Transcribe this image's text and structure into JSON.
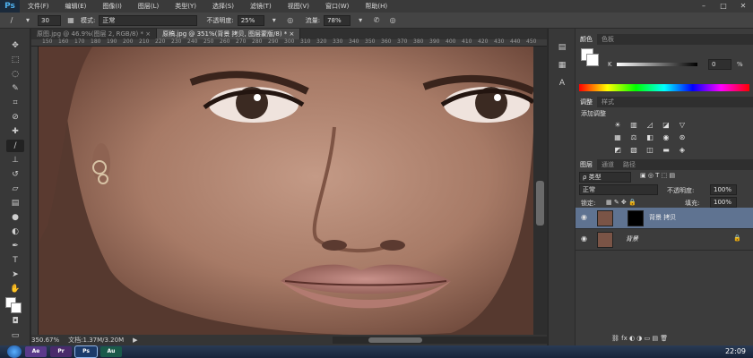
{
  "app": {
    "logo": "Ps"
  },
  "menu": [
    "文件(F)",
    "编辑(E)",
    "图像(I)",
    "图层(L)",
    "类型(Y)",
    "选择(S)",
    "滤镜(T)",
    "视图(V)",
    "窗口(W)",
    "帮助(H)"
  ],
  "options": {
    "brush_size": "30",
    "mode_label": "模式:",
    "mode_value": "正常",
    "opacity_label": "不透明度:",
    "opacity_value": "25%",
    "flow_label": "流量:",
    "flow_value": "78%"
  },
  "tabs": [
    {
      "label": "原图.jpg @ 46.9%(图层 2, RGB/8) *",
      "close": "×"
    },
    {
      "label": "原稿.jpg @ 351%(背景 拷贝, 图层蒙版/8) *",
      "close": "×"
    }
  ],
  "ruler_ticks": [
    "150",
    "160",
    "170",
    "180",
    "190",
    "200",
    "210",
    "220",
    "230",
    "240",
    "250",
    "260",
    "270",
    "280",
    "290",
    "300",
    "310",
    "320",
    "330",
    "340",
    "350",
    "360",
    "370",
    "380",
    "390",
    "400",
    "410",
    "420",
    "430",
    "440",
    "450"
  ],
  "status": {
    "zoom": "350.67%",
    "doc": "文档:1.37M/3.20M"
  },
  "panels": {
    "color_tabs": [
      "颜色",
      "色板"
    ],
    "k_label": "K",
    "k_value": "0",
    "k_unit": "%",
    "adjust_tabs": [
      "调整",
      "样式"
    ],
    "adjust_title": "添加调整",
    "layers_tabs": [
      "图层",
      "通道",
      "路径"
    ],
    "filter_label": "ρ 类型",
    "blend_mode": "正常",
    "opacity_label": "不透明度:",
    "opacity_value": "100%",
    "lock_label": "锁定:",
    "fill_label": "填充:",
    "fill_value": "100%",
    "layers": [
      {
        "name": "背景 拷贝",
        "selected": true
      },
      {
        "name": "背景",
        "selected": false
      }
    ]
  },
  "taskbar": {
    "clock": "22:09",
    "apps": [
      "Ae",
      "Pr",
      "Ps",
      "Au"
    ]
  }
}
